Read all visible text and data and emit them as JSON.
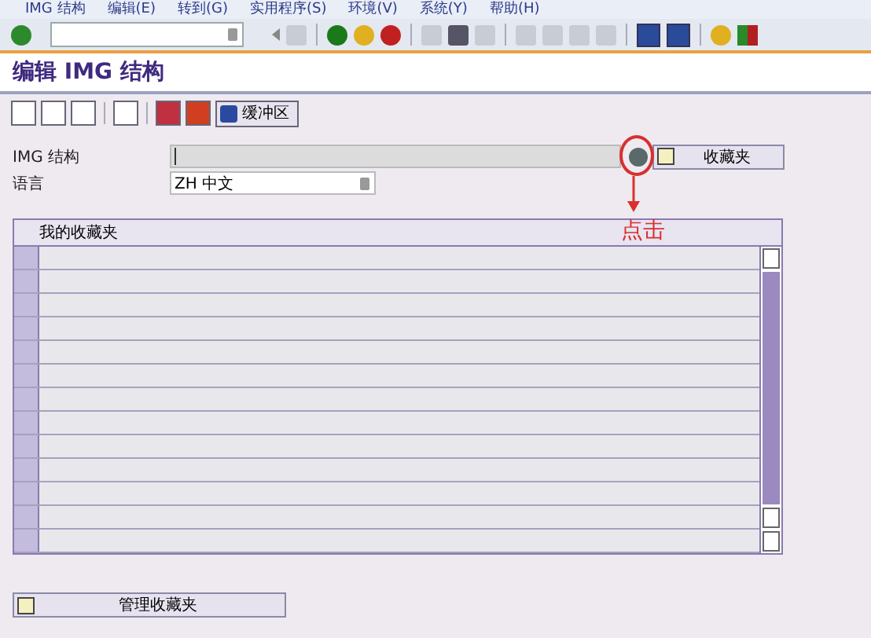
{
  "menu_bar": [
    "IMG 结构",
    "编辑(E)",
    "转到(G)",
    "实用程序(S)",
    "环境(V)",
    "系统(Y)",
    "帮助(H)"
  ],
  "title": "编辑 IMG 结构",
  "app_toolbar": {
    "buffer_button": "缓冲区"
  },
  "form": {
    "structure_label": "IMG 结构",
    "language_label": "语言",
    "language_value": "ZH 中文",
    "favorites_button": "收藏夹"
  },
  "annotation": {
    "text": "点击"
  },
  "table": {
    "columns": [
      "我的收藏夹"
    ]
  },
  "manage_button": "管理收藏夹"
}
